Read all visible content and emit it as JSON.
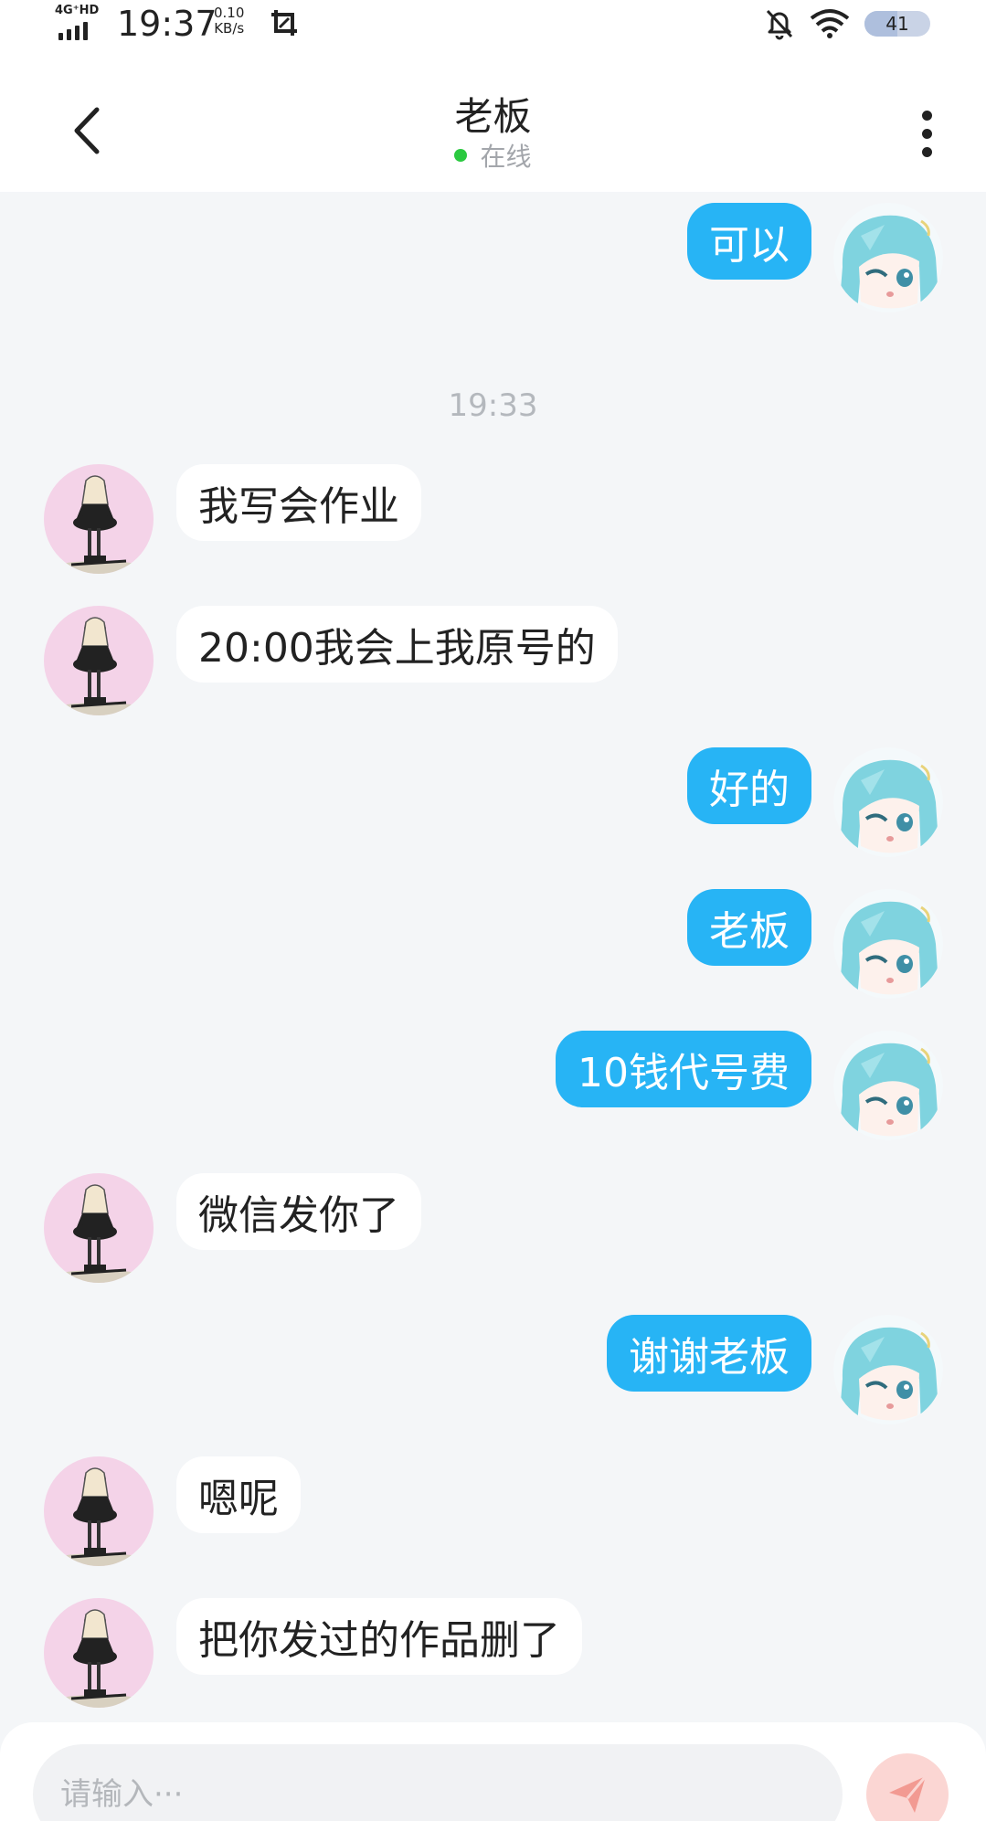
{
  "status_bar": {
    "network": "4G⁺HD",
    "time": "19:37",
    "speed_value": "0.10",
    "speed_unit": "KB/s",
    "battery": "41",
    "icons": [
      "signal-icon",
      "screenshot-icon",
      "mute-bell-icon",
      "wifi-icon",
      "battery-icon"
    ]
  },
  "header": {
    "title": "老板",
    "status": "在线",
    "status_color": "#2bc940"
  },
  "colors": {
    "outgoing_bubble": "#27b4f5",
    "incoming_bubble": "#ffffff",
    "background": "#f4f6f8"
  },
  "messages": [
    {
      "dir": "out",
      "text": "可以"
    },
    {
      "type": "time",
      "text": "19:33"
    },
    {
      "dir": "in",
      "text": "我写会作业"
    },
    {
      "dir": "in",
      "text": "20:00我会上我原号的"
    },
    {
      "dir": "out",
      "text": "好的"
    },
    {
      "dir": "out",
      "text": "老板"
    },
    {
      "dir": "out",
      "text": "10钱代号费"
    },
    {
      "dir": "in",
      "text": "微信发你了"
    },
    {
      "dir": "out",
      "text": "谢谢老板"
    },
    {
      "dir": "in",
      "text": "嗯呢"
    },
    {
      "dir": "in",
      "text": "把你发过的作品删了"
    }
  ],
  "input": {
    "placeholder": "请输入···"
  }
}
